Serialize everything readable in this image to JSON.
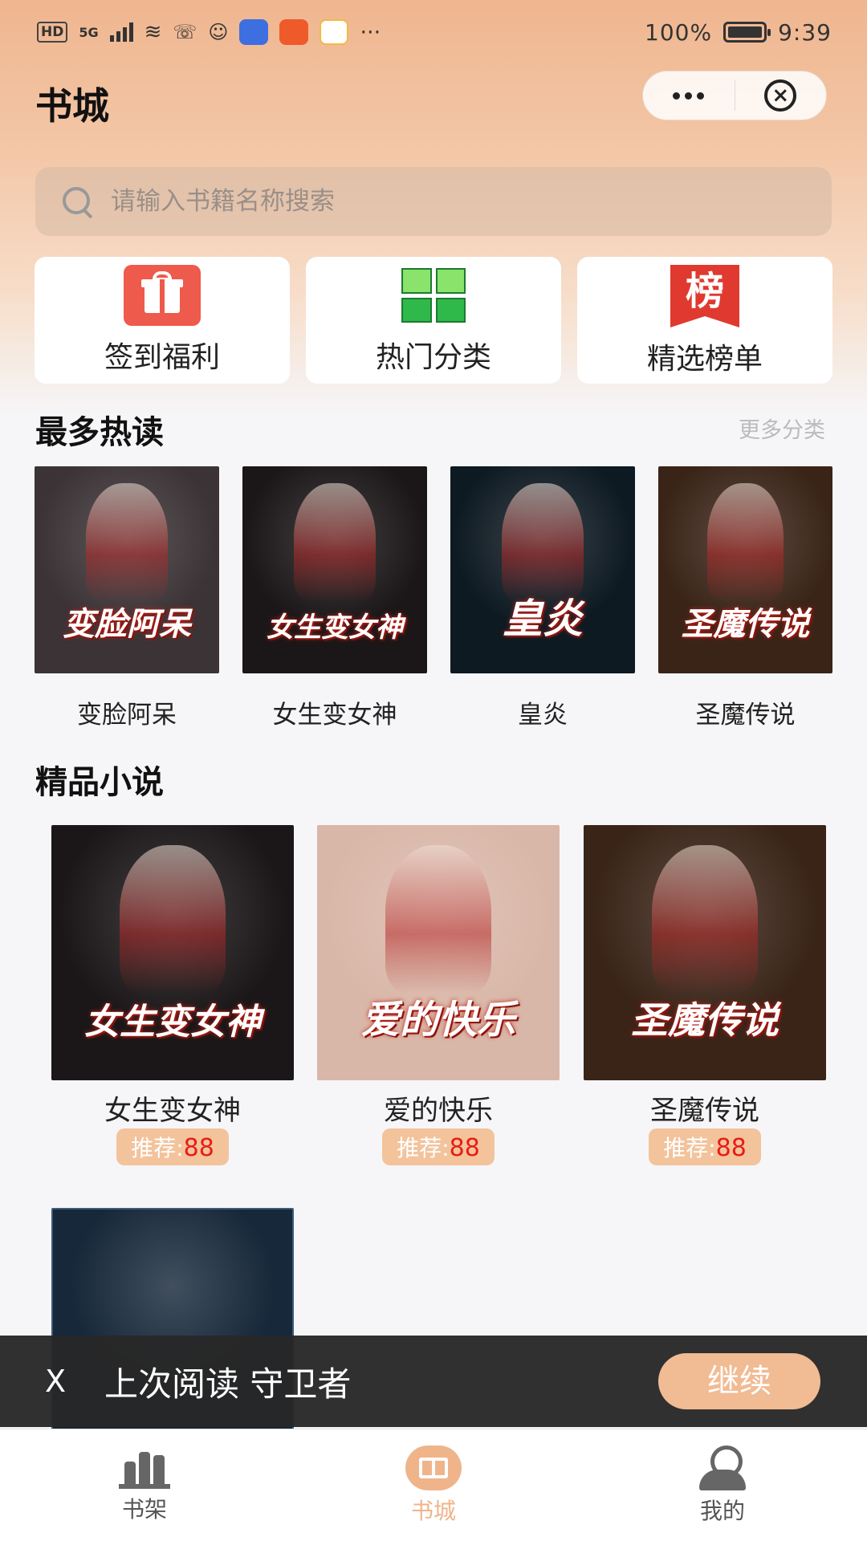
{
  "status_bar": {
    "left_network": "HD",
    "signal_label": "5G",
    "more": "···",
    "battery_text": "100%",
    "time": "9:39"
  },
  "header": {
    "title": "书城"
  },
  "search": {
    "placeholder": "请输入书籍名称搜索"
  },
  "quick_actions": [
    {
      "label": "签到福利",
      "icon": "gift-icon"
    },
    {
      "label": "热门分类",
      "icon": "grid-icon"
    },
    {
      "label": "精选榜单",
      "icon": "ranking-icon",
      "glyph": "榜"
    }
  ],
  "hot": {
    "title": "最多热读",
    "more": "更多分类",
    "books": [
      {
        "name": "变脸阿呆",
        "cover_title": "变脸阿呆",
        "bg": "#3b3336"
      },
      {
        "name": "女生变女神",
        "cover_title": "女生变女神",
        "bg": "#1b1718"
      },
      {
        "name": "皇炎",
        "cover_title": "皇炎",
        "bg": "#0e1a22"
      },
      {
        "name": "圣魔传说",
        "cover_title": "圣魔传说",
        "bg": "#3a2418"
      }
    ]
  },
  "featured": {
    "title": "精品小说",
    "badge_prefix": "推荐:",
    "books": [
      {
        "name": "女生变女神",
        "cover_title": "女生变女神",
        "score": "88",
        "bg": "#1b1718"
      },
      {
        "name": "爱的快乐",
        "cover_title": "爱的快乐",
        "score": "88",
        "bg": "#d9b7a8"
      },
      {
        "name": "圣魔传说",
        "cover_title": "圣魔传说",
        "score": "88",
        "bg": "#3a2418"
      },
      {
        "name": "",
        "cover_title": "",
        "score": "",
        "bg": "#17283a"
      }
    ]
  },
  "last_read": {
    "close": "X",
    "text": "上次阅读 守卫者",
    "continue": "继续"
  },
  "tabs": [
    {
      "label": "书架",
      "active": false
    },
    {
      "label": "书城",
      "active": true
    },
    {
      "label": "我的",
      "active": false
    }
  ],
  "colors": {
    "accent": "#f0b48b",
    "badge_number": "#e81c14",
    "gift_red": "#ee5a4b",
    "rank_red": "#e03a30"
  }
}
